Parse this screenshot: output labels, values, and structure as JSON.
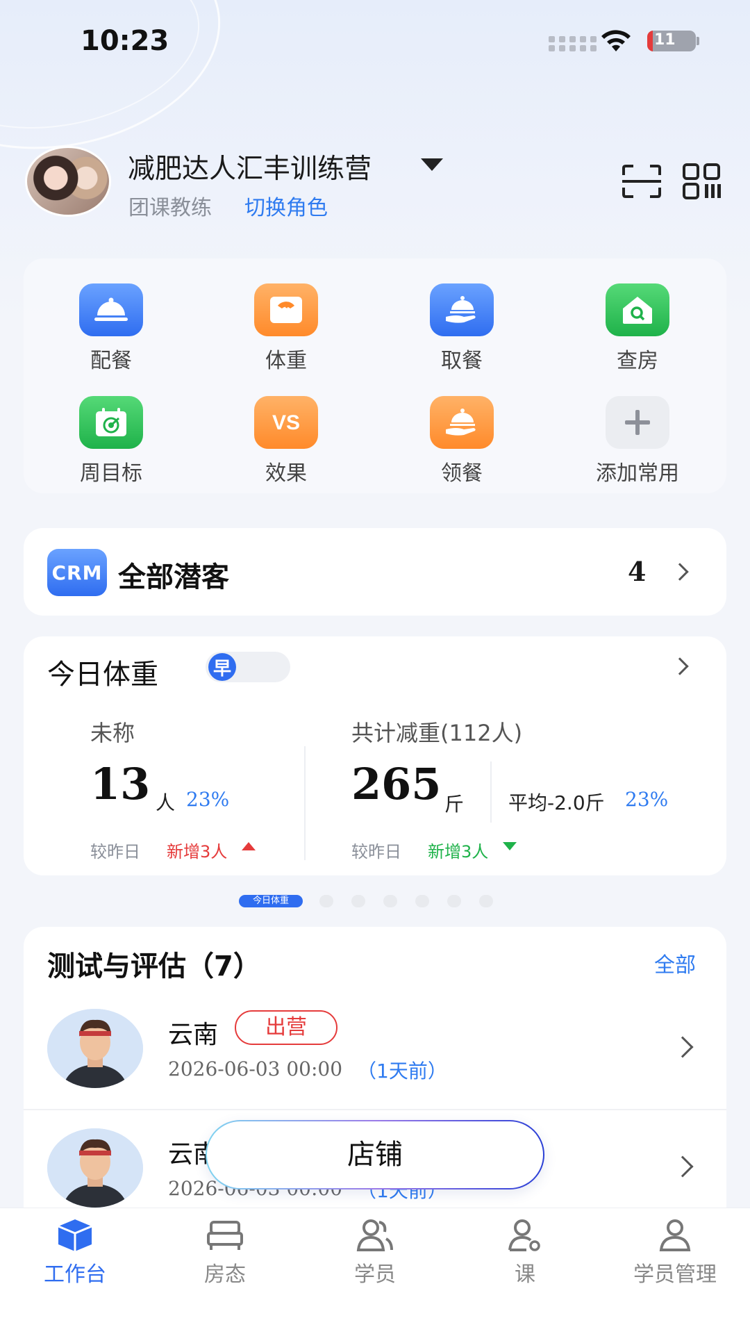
{
  "status_bar": {
    "time": "10:23",
    "battery": "11"
  },
  "header": {
    "org_name": "减肥达人汇丰训练营",
    "role": "团课教练",
    "switch_role": "切换角色"
  },
  "quick_actions": [
    {
      "label": "配餐",
      "icon": "food-cover-icon",
      "color": "blue"
    },
    {
      "label": "体重",
      "icon": "scale-icon",
      "color": "orange"
    },
    {
      "label": "取餐",
      "icon": "meal-pickup-icon",
      "color": "blue"
    },
    {
      "label": "查房",
      "icon": "room-check-icon",
      "color": "green"
    },
    {
      "label": "周目标",
      "icon": "calendar-target-icon",
      "color": "green"
    },
    {
      "label": "效果",
      "icon": "vs-icon",
      "color": "orange"
    },
    {
      "label": "领餐",
      "icon": "meal-receive-icon",
      "color": "orange"
    },
    {
      "label": "添加常用",
      "icon": "plus-icon",
      "color": "gray"
    }
  ],
  "crm": {
    "badge": "CRM",
    "title": "全部潜客",
    "count": "4"
  },
  "weight_today": {
    "title": "今日体重",
    "toggle_label": "早",
    "left": {
      "label": "未称",
      "value": "13",
      "unit": "人",
      "pct": "23%",
      "compare_label": "较昨日",
      "change": "新增3人"
    },
    "right": {
      "label": "共计减重(112人)",
      "value": "265",
      "unit": "斤",
      "avg": "平均-2.0斤",
      "pct": "23%",
      "compare_label": "较昨日",
      "change": "新增3人"
    }
  },
  "pager": {
    "active_label": "今日体重"
  },
  "tests": {
    "title": "测试与评估（7）",
    "all": "全部",
    "rows": [
      {
        "name": "云南",
        "tag": "出营",
        "date": "2026-06-03 00:00",
        "ago": "（1天前）"
      },
      {
        "name": "云南",
        "tag": "",
        "date": "2026-06-03 00:00",
        "ago": "（1天前）"
      }
    ]
  },
  "store_button": "店铺",
  "bottom_nav": [
    {
      "label": "工作台",
      "active": true
    },
    {
      "label": "房态",
      "active": false
    },
    {
      "label": "学员",
      "active": false
    },
    {
      "label": "课",
      "active": false
    },
    {
      "label": "学员管理",
      "active": false
    }
  ],
  "colors": {
    "accent": "#2f6df0",
    "link": "#2f7bf0",
    "up": "#e53b3b",
    "down": "#1fb24a"
  }
}
